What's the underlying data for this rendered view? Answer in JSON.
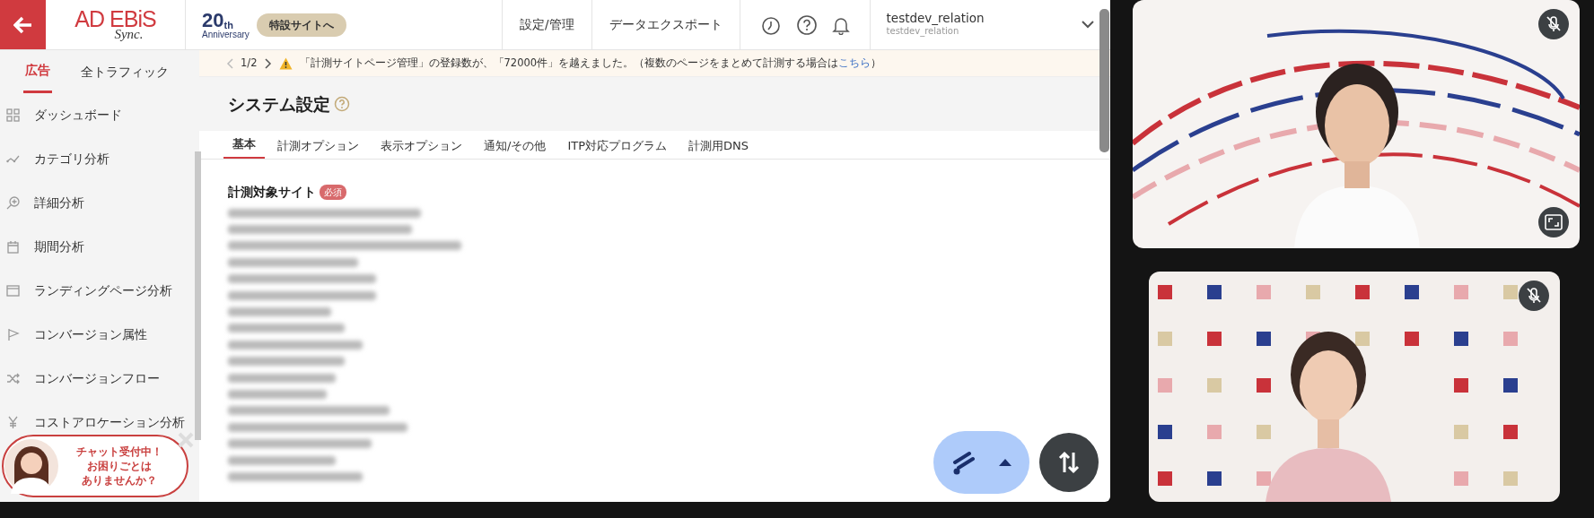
{
  "header": {
    "logo": {
      "main": "AD EBiS",
      "sub": "Sync."
    },
    "anniversary": {
      "number": "20",
      "suffix": "th",
      "label": "Anniversary"
    },
    "special_button": "特設サイトへ",
    "nav": [
      "設定/管理",
      "データエクスポート"
    ],
    "user": {
      "name": "testdev_relation",
      "account": "testdev_relation"
    }
  },
  "sidebar": {
    "tabs": [
      {
        "label": "広告",
        "selected": true
      },
      {
        "label": "全トラフィック",
        "selected": false
      }
    ],
    "items": [
      "ダッシュボード",
      "カテゴリ分析",
      "詳細分析",
      "期間分析",
      "ランディングページ分析",
      "コンバージョン属性",
      "コンバージョンフロー",
      "コストアロケーション分析"
    ]
  },
  "notice": {
    "pager": "1/2",
    "text": "「計測サイトページ管理」の登録数が、「72000件」を越えました。（複数のページをまとめて計測する場合は",
    "link": "こちら",
    "after": "）"
  },
  "page": {
    "title": "システム設定",
    "tabs": [
      {
        "label": "基本",
        "selected": true
      },
      {
        "label": "計測オプション",
        "selected": false
      },
      {
        "label": "表示オプション",
        "selected": false
      },
      {
        "label": "通知/その他",
        "selected": false
      },
      {
        "label": "ITP対応プログラム",
        "selected": false
      },
      {
        "label": "計測用DNS",
        "selected": false
      }
    ],
    "section": {
      "label": "計測対象サイト",
      "badge": "必須"
    }
  },
  "chat": {
    "lines": [
      "チャット受付中！",
      "お困りごとは",
      "ありませんか？"
    ]
  },
  "video_tiles": [
    {
      "kind": "picture",
      "muted": true
    },
    {
      "kind": "picture",
      "muted": true
    }
  ]
}
